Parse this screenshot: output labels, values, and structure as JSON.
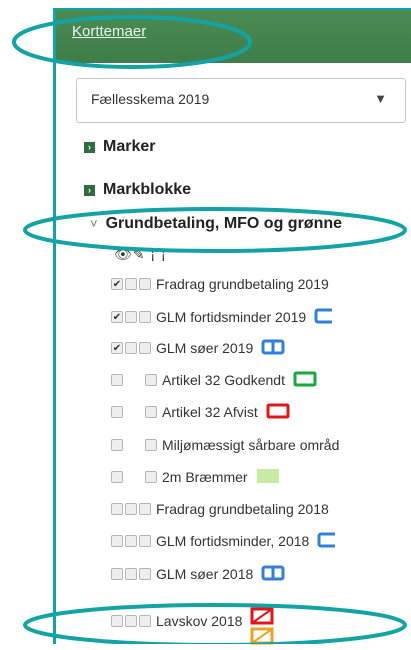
{
  "header": {
    "title": "Korttemaer"
  },
  "select": {
    "value": "Fællesskema 2019",
    "caret": "▼"
  },
  "sections": [
    {
      "label": "Marker",
      "icon": "expand-box-icon"
    },
    {
      "label": "Markblokke",
      "icon": "expand-box-icon"
    }
  ],
  "open_section": {
    "label": "Grundbetaling, MFO og grønne",
    "chevron": "˅"
  },
  "tools": "👁✎ ¡ ¡",
  "layers": [
    {
      "label": "Fradrag grundbetaling 2019",
      "checked": true,
      "swatch": ""
    },
    {
      "label": "GLM fortidsminder 2019",
      "checked": true,
      "swatch": "blue-half"
    },
    {
      "label": "GLM søer 2019",
      "checked": true,
      "swatch": "blue-split"
    },
    {
      "label": "Artikel 32 Godkendt",
      "checked": false,
      "swatch": "green"
    },
    {
      "label": "Artikel 32 Afvist",
      "checked": false,
      "swatch": "red"
    },
    {
      "label": "Miljømæssigt sårbare områd",
      "checked": false,
      "swatch": ""
    },
    {
      "label": "2m Bræmmer",
      "checked": false,
      "swatch": "light-green"
    },
    {
      "label": "Fradrag grundbetaling 2018",
      "checked": false,
      "swatch": ""
    },
    {
      "label": "GLM fortidsminder, 2018",
      "checked": false,
      "swatch": "blue-half"
    },
    {
      "label": "GLM søer 2018",
      "checked": false,
      "swatch": "blue-split"
    },
    {
      "label": "Lavskov 2018",
      "checked": false,
      "swatch": "red-orange-cross"
    }
  ],
  "colors": {
    "accent": "#12a3a6",
    "header": "#3f7d49",
    "blue": "#2f7fe0",
    "green": "#19a83a",
    "red": "#e3151b",
    "orange": "#f0a020",
    "lightgreen": "#c9eaa3"
  }
}
